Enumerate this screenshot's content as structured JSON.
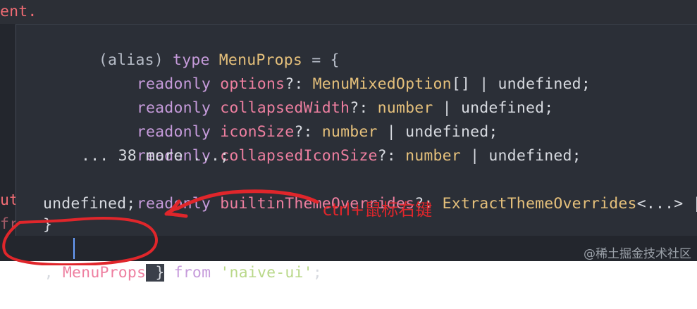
{
  "editor": {
    "top_fragment": "ent.",
    "hover": {
      "lines": [
        {
          "alias": "(alias)",
          "type_kw": "type",
          "name": "MenuProps",
          "rest": " = {"
        },
        {
          "kw": "readonly",
          "prop": "options",
          "sep": "?: ",
          "type": "MenuMixedOption",
          "tail": "[] | undefined;"
        },
        {
          "kw": "readonly",
          "prop": "collapsedWidth",
          "sep": "?: ",
          "type": "number",
          "tail": " | undefined;"
        },
        {
          "kw": "readonly",
          "prop": "iconSize",
          "sep": "?: ",
          "type": "number",
          "tail": " | undefined;"
        },
        {
          "kw": "readonly",
          "prop": "collapsedIconSize",
          "sep": "?: ",
          "type": "number",
          "tail": " | undefined;"
        },
        {
          "more": "... 38 more ...;"
        },
        {
          "kw": "readonly",
          "prop": "builtinThemeOverrides",
          "sep": "?: ",
          "type": "ExtractThemeOverrides",
          "tail": "<...> |"
        },
        {
          "tail": "undefined;"
        },
        {
          "tail": "}"
        }
      ],
      "gutter_fragments": [
        "ut",
        "fr"
      ]
    },
    "import_line": {
      "comma": ",",
      "name_a": "MenuProps",
      "brace": " }",
      "from_kw": "from",
      "module": "'naive-ui'",
      "end": ";"
    }
  },
  "annotation": {
    "text": "ctrl+鼠标右键",
    "color": "#e0262b"
  },
  "watermark": "@稀土掘金技术社区"
}
